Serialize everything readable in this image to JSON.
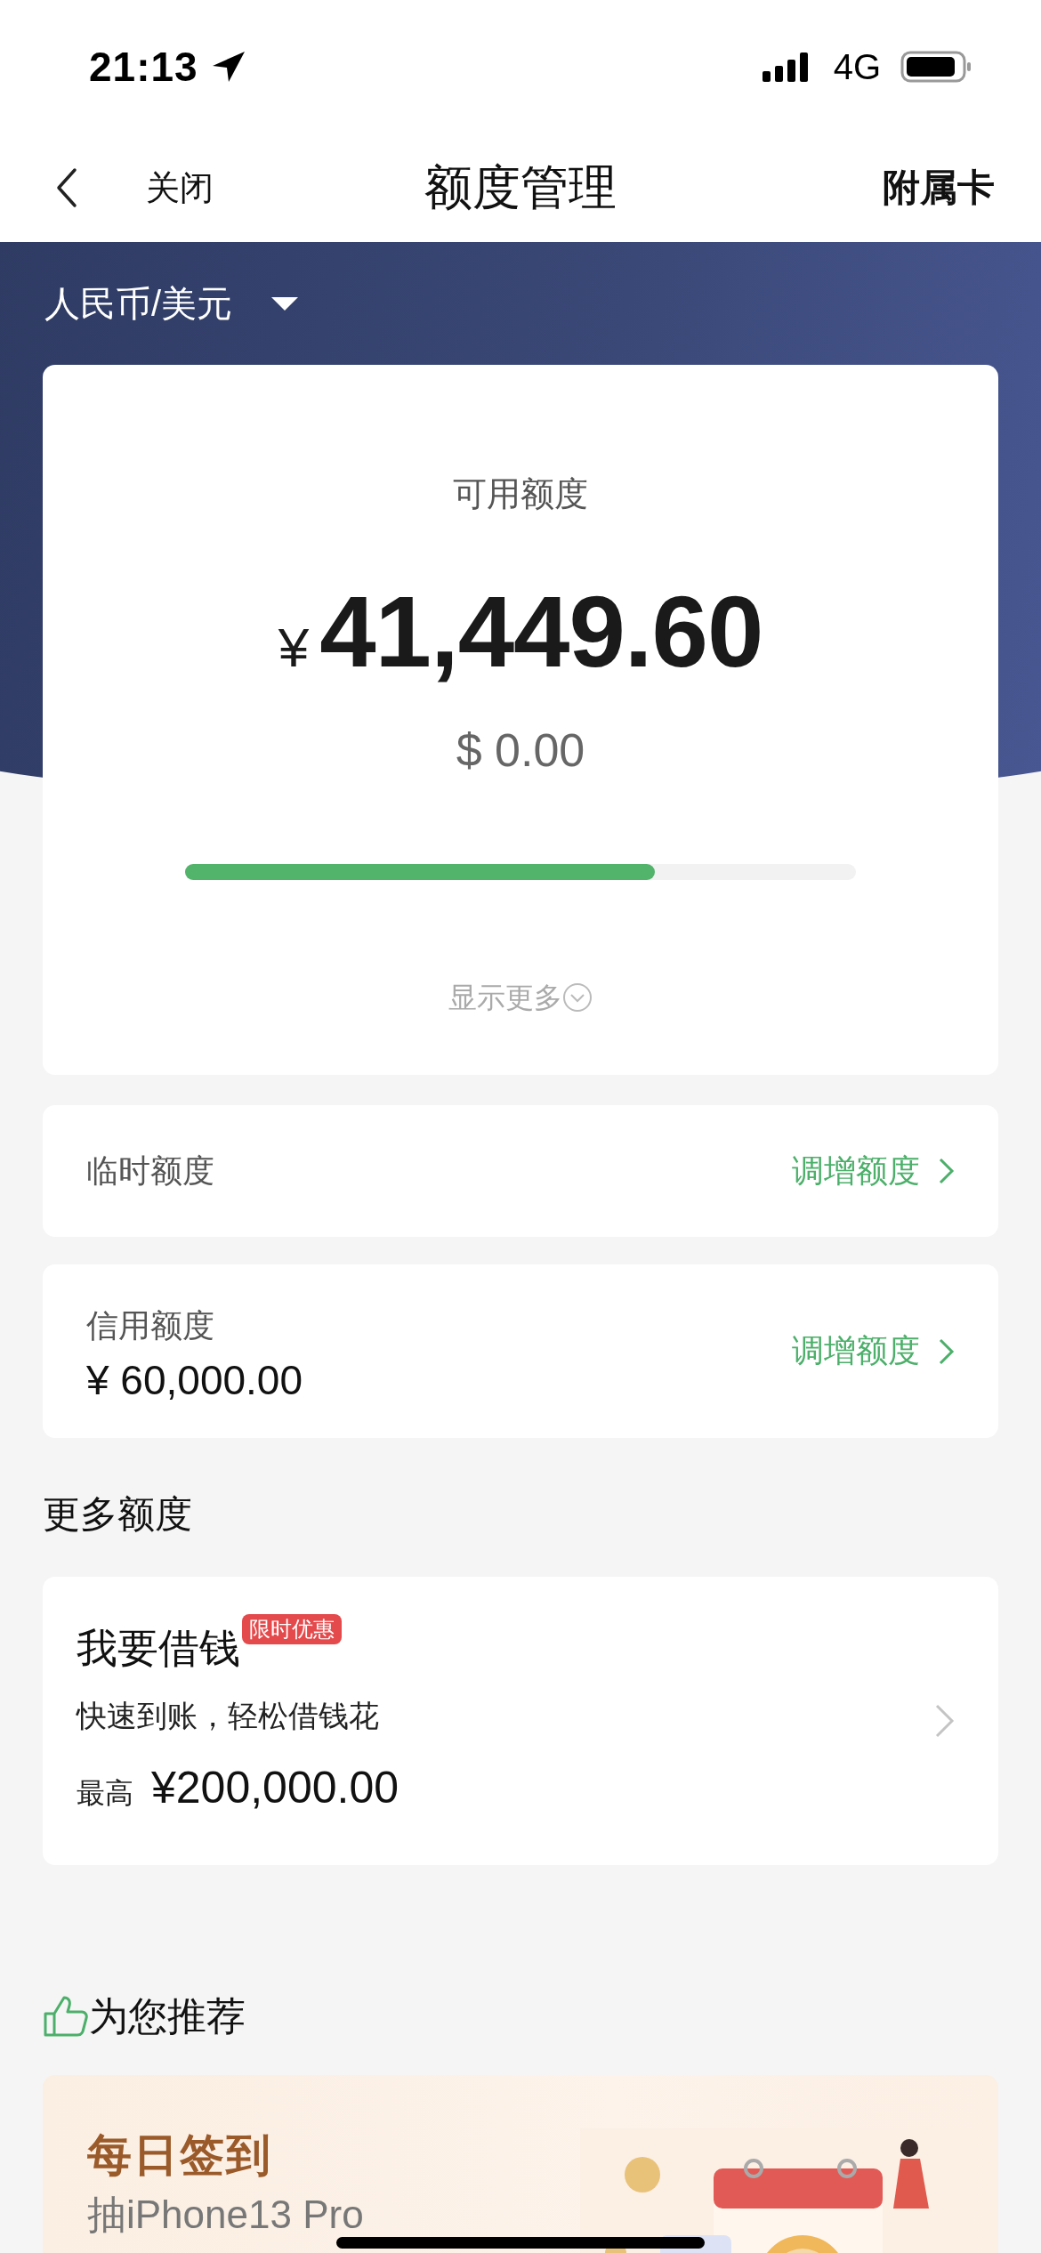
{
  "status_bar": {
    "time": "21:13",
    "network": "4G"
  },
  "nav": {
    "close": "关闭",
    "title": "额度管理",
    "action": "附属卡"
  },
  "currency_selector": {
    "label": "人民币/美元"
  },
  "available": {
    "label": "可用额度",
    "currency_symbol": "¥",
    "amount": "41,449.60",
    "usd": "$ 0.00",
    "level": 0.7,
    "show_more": "显示更多"
  },
  "limits": [
    {
      "kind": "simple",
      "label": "临时额度",
      "action": "调增额度"
    },
    {
      "kind": "amount",
      "label": "信用额度",
      "amount": "¥ 60,000.00",
      "action": "调增额度"
    }
  ],
  "more_section": {
    "title": "更多额度",
    "loan": {
      "title": "我要借钱",
      "badge": "限时优惠",
      "subtitle": "快速到账，轻松借钱花",
      "max_label": "最高",
      "max_amount": "¥200,000.00"
    }
  },
  "recommend": {
    "title": "为您推荐",
    "promo": {
      "title": "每日签到",
      "subtitle": "抽iPhone13 Pro"
    }
  }
}
